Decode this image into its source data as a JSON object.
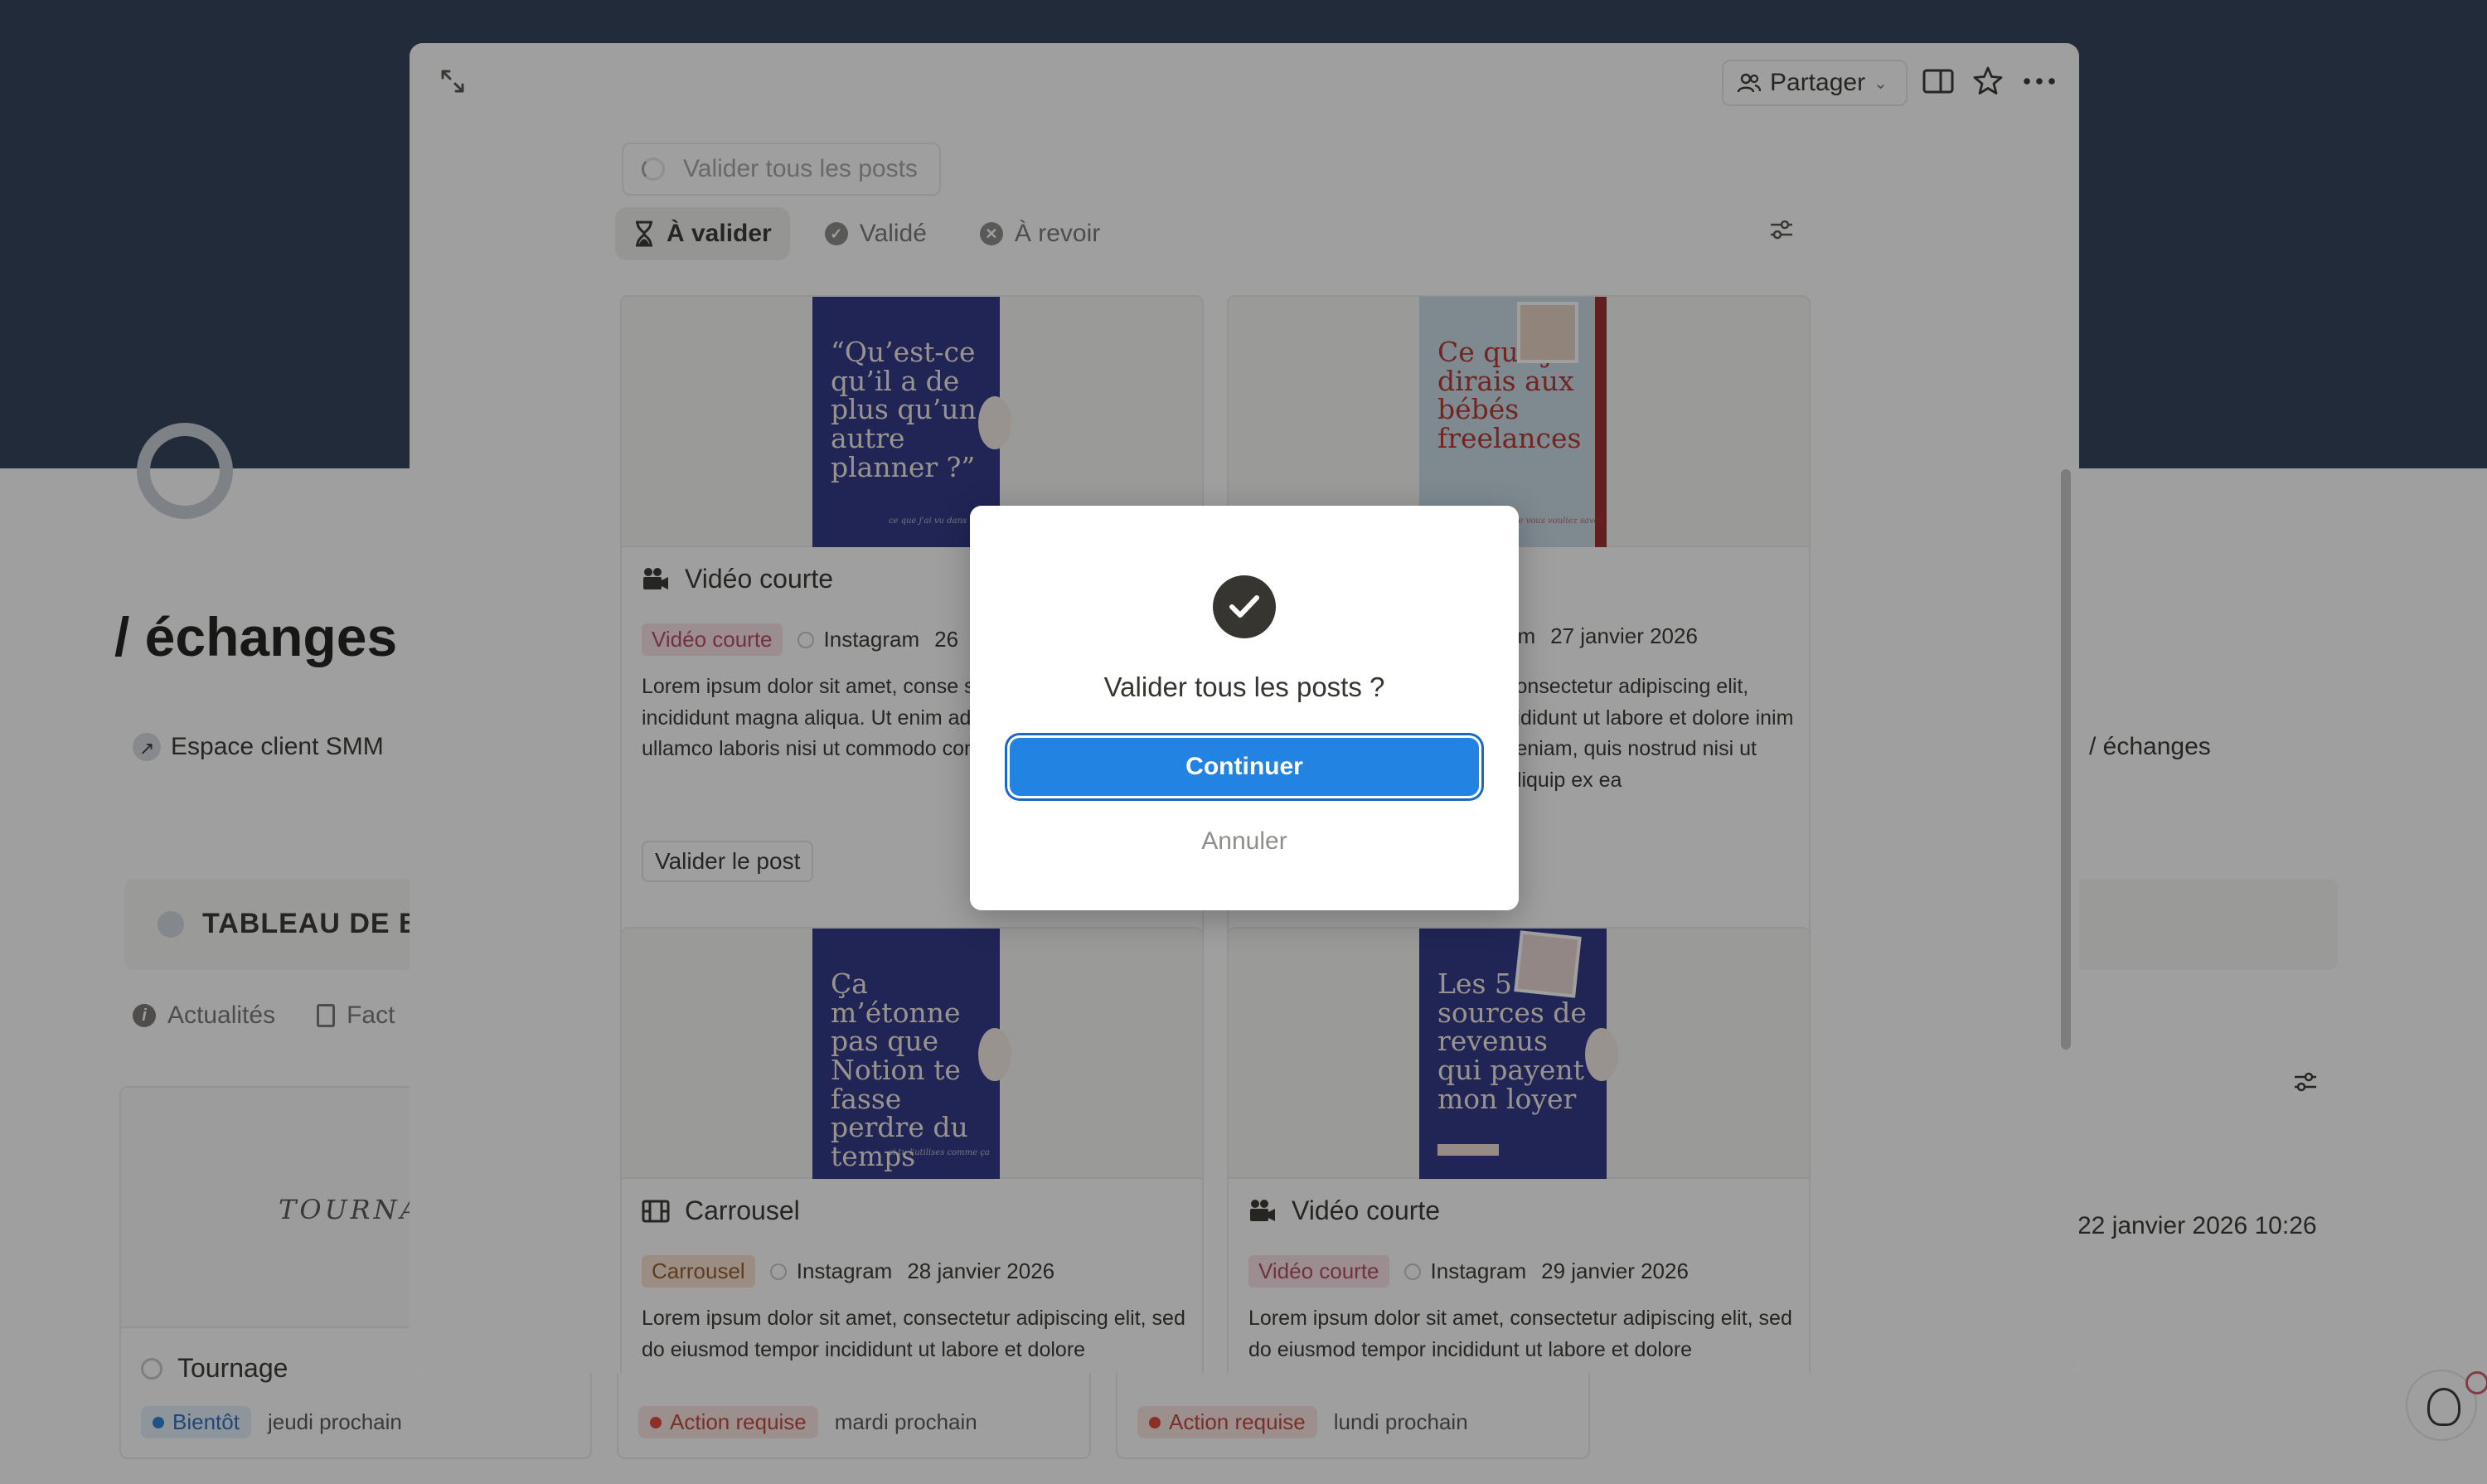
{
  "background": {
    "page_title": "/ échanges",
    "link_left": "Espace client SMM",
    "link_right": "/ échanges",
    "board_title": "TABLEAU DE BO",
    "tabs": [
      "Actualités",
      "Fact"
    ],
    "card_scrawl": "TOURNAG",
    "card_title": "Tournage",
    "status_soon": "Bientôt",
    "status_soon_date": "jeudi prochain",
    "status_action_1": "Action requise",
    "status_action_1_date": "mardi prochain",
    "status_action_2": "Action requise",
    "status_action_2_date": "lundi prochain",
    "right_date": "22 janvier 2026 10:26"
  },
  "peek": {
    "share_label": "Partager",
    "validate_all_label": "Valider tous les posts",
    "filters": [
      {
        "label": "À valider",
        "icon": "hourglass-icon",
        "active": true
      },
      {
        "label": "Validé",
        "icon": "check-circle-icon",
        "active": false
      },
      {
        "label": "À revoir",
        "icon": "x-circle-icon",
        "active": false
      }
    ],
    "posts": [
      {
        "title": "Vidéo courte",
        "type_tag": "Vidéo courte",
        "platform": "Instagram",
        "date": "26",
        "description": "Lorem ipsum dolor sit amet, conse sed do eiusmod tempor incididunt magna aliqua. Ut enim ad minim ve exercitation ullamco laboris nisi ut commodo consequat.",
        "button": "Valider le post",
        "thumb_text": "“Qu’est-ce qu’il a de plus qu’un autre planner ?”",
        "thumb_small": "ce que j'ai vu dans"
      },
      {
        "title": "",
        "type_tag": "",
        "platform": "am",
        "date": "27 janvier 2026",
        "description": "consectetur adipiscing elit, cididunt ut labore et dolore inim veniam, quis nostrud nisi ut aliquip ex ea",
        "thumb_text": "Ce que je dirais aux bébés freelances",
        "thumb_small": "ce que vous vouliez savoir"
      },
      {
        "title": "Carrousel",
        "type_tag": "Carrousel",
        "platform": "Instagram",
        "date": "28 janvier 2026",
        "description": "Lorem ipsum dolor sit amet, consectetur adipiscing elit, sed do eiusmod tempor incididunt ut labore et dolore",
        "thumb_text": "Ça m’étonne pas que Notion te fasse perdre du temps",
        "thumb_small": "si tu l'utilises comme ça"
      },
      {
        "title": "Vidéo courte",
        "type_tag": "Vidéo courte",
        "platform": "Instagram",
        "date": "29 janvier 2026",
        "description": "Lorem ipsum dolor sit amet, consectetur adipiscing elit, sed do eiusmod tempor incididunt ut labore et dolore",
        "thumb_text": "Les 5 sources de revenus qui payent mon loyer"
      }
    ]
  },
  "modal": {
    "title": "Valider tous les posts ?",
    "continue_label": "Continuer",
    "cancel_label": "Annuler"
  },
  "colors": {
    "primary": "#2383e2",
    "cover": "#2d3e55",
    "thumb_navy": "#2e3584",
    "thumb_light": "#c8dbe6",
    "thumb_red": "#b8322c"
  }
}
